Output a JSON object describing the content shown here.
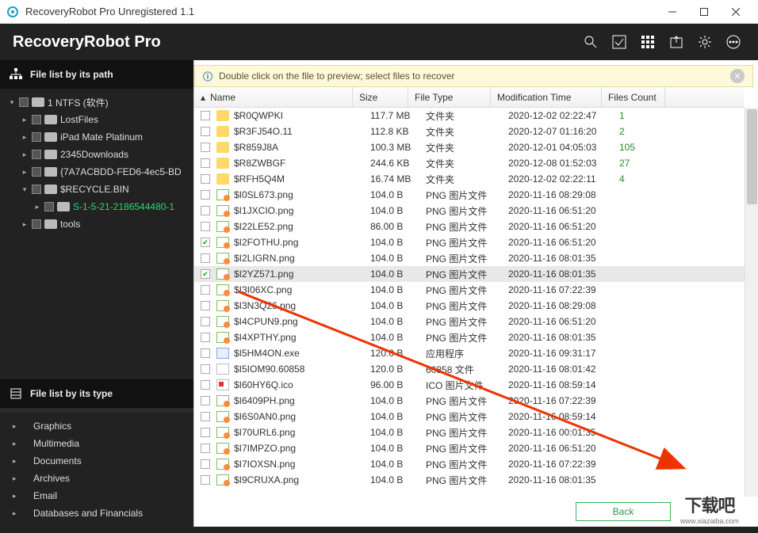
{
  "window": {
    "title": "RecoveryRobot Pro Unregistered 1.1"
  },
  "brand": "RecoveryRobot Pro",
  "sidebar": {
    "path_header": "File list by its path",
    "type_header": "File list by its type",
    "tree": [
      {
        "label": "1 NTFS (软件)",
        "depth": 0,
        "caret": "▾",
        "sel": false
      },
      {
        "label": "LostFiles",
        "depth": 1,
        "caret": "▸",
        "sel": false
      },
      {
        "label": "iPad Mate Platinum",
        "depth": 1,
        "caret": "▸",
        "sel": false
      },
      {
        "label": "2345Downloads",
        "depth": 1,
        "caret": "▸",
        "sel": false
      },
      {
        "label": "{7A7ACBDD-FED6-4ec5-BD",
        "depth": 1,
        "caret": "▸",
        "sel": false
      },
      {
        "label": "$RECYCLE.BIN",
        "depth": 1,
        "caret": "▾",
        "sel": false
      },
      {
        "label": "S-1-5-21-2186544480-1",
        "depth": 2,
        "caret": "▸",
        "sel": true
      },
      {
        "label": "tools",
        "depth": 1,
        "caret": "▸",
        "sel": false
      }
    ],
    "types": [
      {
        "label": "Graphics"
      },
      {
        "label": "Multimedia"
      },
      {
        "label": "Documents"
      },
      {
        "label": "Archives"
      },
      {
        "label": "Email"
      },
      {
        "label": "Databases and Financials"
      }
    ]
  },
  "notice": {
    "text": "Double click on the file to preview; select files to recover"
  },
  "columns": {
    "name": "Name",
    "size": "Size",
    "type": "File Type",
    "mod": "Modification Time",
    "count": "Files Count"
  },
  "files": [
    {
      "n": "$R0QWPKI",
      "s": "117.7 MB",
      "t": "文件夹",
      "m": "2020-12-02 02:22:47",
      "c": "1",
      "k": "folder",
      "chk": false
    },
    {
      "n": "$R3FJ54O.11",
      "s": "112.8 KB",
      "t": "文件夹",
      "m": "2020-12-07 01:16:20",
      "c": "2",
      "k": "folder",
      "chk": false
    },
    {
      "n": "$R859J8A",
      "s": "100.3 MB",
      "t": "文件夹",
      "m": "2020-12-01 04:05:03",
      "c": "105",
      "k": "folder",
      "chk": false
    },
    {
      "n": "$R8ZWBGF",
      "s": "244.6 KB",
      "t": "文件夹",
      "m": "2020-12-08 01:52:03",
      "c": "27",
      "k": "folder",
      "chk": false
    },
    {
      "n": "$RFH5Q4M",
      "s": "16.74 MB",
      "t": "文件夹",
      "m": "2020-12-02 02:22:11",
      "c": "4",
      "k": "folder",
      "chk": false
    },
    {
      "n": "$I0SL673.png",
      "s": "104.0 B",
      "t": "PNG 图片文件",
      "m": "2020-11-16 08:29:08",
      "c": "",
      "k": "png",
      "chk": false
    },
    {
      "n": "$I1JXCIO.png",
      "s": "104.0 B",
      "t": "PNG 图片文件",
      "m": "2020-11-16 06:51:20",
      "c": "",
      "k": "png",
      "chk": false
    },
    {
      "n": "$I22LE52.png",
      "s": "86.00 B",
      "t": "PNG 图片文件",
      "m": "2020-11-16 06:51:20",
      "c": "",
      "k": "png",
      "chk": false
    },
    {
      "n": "$I2FOTHU.png",
      "s": "104.0 B",
      "t": "PNG 图片文件",
      "m": "2020-11-16 06:51:20",
      "c": "",
      "k": "png",
      "chk": true
    },
    {
      "n": "$I2LIGRN.png",
      "s": "104.0 B",
      "t": "PNG 图片文件",
      "m": "2020-11-16 08:01:35",
      "c": "",
      "k": "png",
      "chk": false
    },
    {
      "n": "$I2YZ571.png",
      "s": "104.0 B",
      "t": "PNG 图片文件",
      "m": "2020-11-16 08:01:35",
      "c": "",
      "k": "png",
      "chk": true,
      "sel": true
    },
    {
      "n": "$I3I06XC.png",
      "s": "104.0 B",
      "t": "PNG 图片文件",
      "m": "2020-11-16 07:22:39",
      "c": "",
      "k": "png",
      "chk": false
    },
    {
      "n": "$I3N3Q26.png",
      "s": "104.0 B",
      "t": "PNG 图片文件",
      "m": "2020-11-16 08:29:08",
      "c": "",
      "k": "png",
      "chk": false
    },
    {
      "n": "$I4CPUN9.png",
      "s": "104.0 B",
      "t": "PNG 图片文件",
      "m": "2020-11-16 06:51:20",
      "c": "",
      "k": "png",
      "chk": false
    },
    {
      "n": "$I4XPTHY.png",
      "s": "104.0 B",
      "t": "PNG 图片文件",
      "m": "2020-11-16 08:01:35",
      "c": "",
      "k": "png",
      "chk": false
    },
    {
      "n": "$I5HM4ON.exe",
      "s": "120.0 B",
      "t": "应用程序",
      "m": "2020-11-16 09:31:17",
      "c": "",
      "k": "exe",
      "chk": false
    },
    {
      "n": "$I5IOM90.60858",
      "s": "120.0 B",
      "t": "60858 文件",
      "m": "2020-11-16 08:01:42",
      "c": "",
      "k": "file",
      "chk": false
    },
    {
      "n": "$I60HY6Q.ico",
      "s": "96.00 B",
      "t": "ICO 图片文件",
      "m": "2020-11-16 08:59:14",
      "c": "",
      "k": "icof",
      "chk": false
    },
    {
      "n": "$I6409PH.png",
      "s": "104.0 B",
      "t": "PNG 图片文件",
      "m": "2020-11-16 07:22:39",
      "c": "",
      "k": "png",
      "chk": false
    },
    {
      "n": "$I6S0AN0.png",
      "s": "104.0 B",
      "t": "PNG 图片文件",
      "m": "2020-11-16 08:59:14",
      "c": "",
      "k": "png",
      "chk": false
    },
    {
      "n": "$I70URL6.png",
      "s": "104.0 B",
      "t": "PNG 图片文件",
      "m": "2020-11-16 00:01:35",
      "c": "",
      "k": "png",
      "chk": false
    },
    {
      "n": "$I7IMPZO.png",
      "s": "104.0 B",
      "t": "PNG 图片文件",
      "m": "2020-11-16 06:51:20",
      "c": "",
      "k": "png",
      "chk": false
    },
    {
      "n": "$I7IOXSN.png",
      "s": "104.0 B",
      "t": "PNG 图片文件",
      "m": "2020-11-16 07:22:39",
      "c": "",
      "k": "png",
      "chk": false
    },
    {
      "n": "$I9CRUXA.png",
      "s": "104.0 B",
      "t": "PNG 图片文件",
      "m": "2020-11-16 08:01:35",
      "c": "",
      "k": "png",
      "chk": false
    }
  ],
  "footer": {
    "back": "Back"
  },
  "watermark": {
    "big": "下载吧",
    "small": "www.xiazaiba.com"
  }
}
